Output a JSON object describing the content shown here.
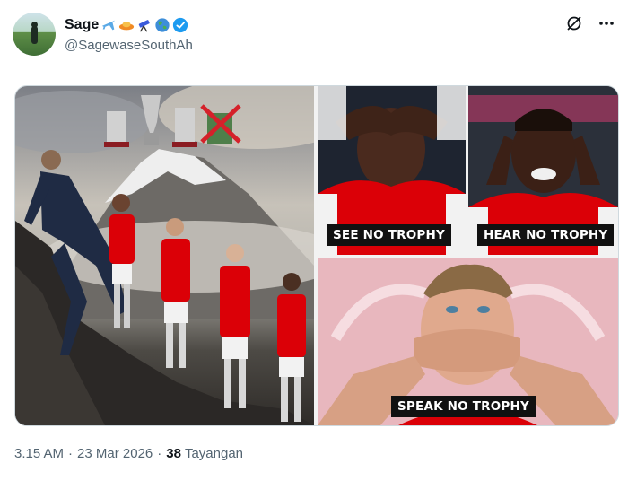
{
  "tweet": {
    "display_name": "Sage",
    "handle": "@SagewaseSouthAh",
    "emojis": [
      "airplane-icon",
      "ufo-icon",
      "telescope-icon",
      "globe-icon"
    ],
    "verified": true
  },
  "header_icons": [
    "grok-icon",
    "more-icon"
  ],
  "media": {
    "captions": [
      "SEE NO TROPHY",
      "HEAR NO TROPHY",
      "SPEAK NO TROPHY"
    ]
  },
  "footer": {
    "time": "3.15 AM",
    "separator": "·",
    "date": "23 Mar 2026",
    "views_count": "38",
    "views_label": "Tayangan"
  },
  "colors": {
    "verified_blue": "#1d9bf0",
    "secondary_text": "#536471",
    "arsenal_red": "#db0007"
  }
}
